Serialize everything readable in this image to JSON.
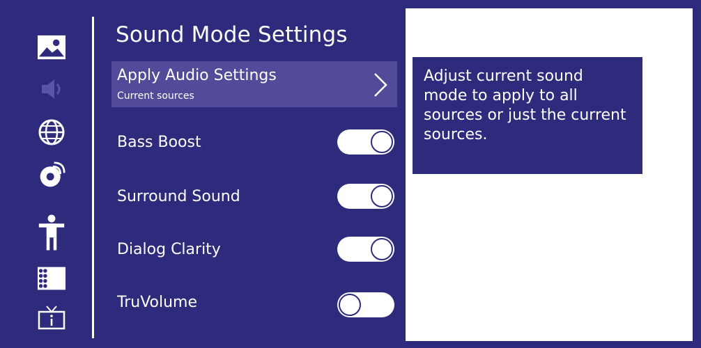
{
  "colors": {
    "background": "#2e2a7c",
    "selected_row": "#524b99",
    "panel": "#ffffff",
    "text": "#ffffff"
  },
  "sidebar": {
    "icons": [
      {
        "name": "picture-icon",
        "active": true
      },
      {
        "name": "audio-icon",
        "active": false
      },
      {
        "name": "network-icon",
        "active": true
      },
      {
        "name": "channels-icon",
        "active": true
      },
      {
        "name": "accessibility-icon",
        "active": true
      },
      {
        "name": "system-icon",
        "active": true
      },
      {
        "name": "tv-info-icon",
        "active": true
      }
    ]
  },
  "main": {
    "title": "Sound Mode Settings",
    "apply_audio": {
      "label": "Apply Audio Settings",
      "sub": "Current sources"
    },
    "toggles": [
      {
        "label": "Bass Boost",
        "on": true
      },
      {
        "label": "Surround Sound",
        "on": true
      },
      {
        "label": "Dialog Clarity",
        "on": true
      },
      {
        "label": "TruVolume",
        "on": false
      }
    ]
  },
  "help": {
    "text": "Adjust current sound mode to apply to all sources or just the current sources."
  }
}
